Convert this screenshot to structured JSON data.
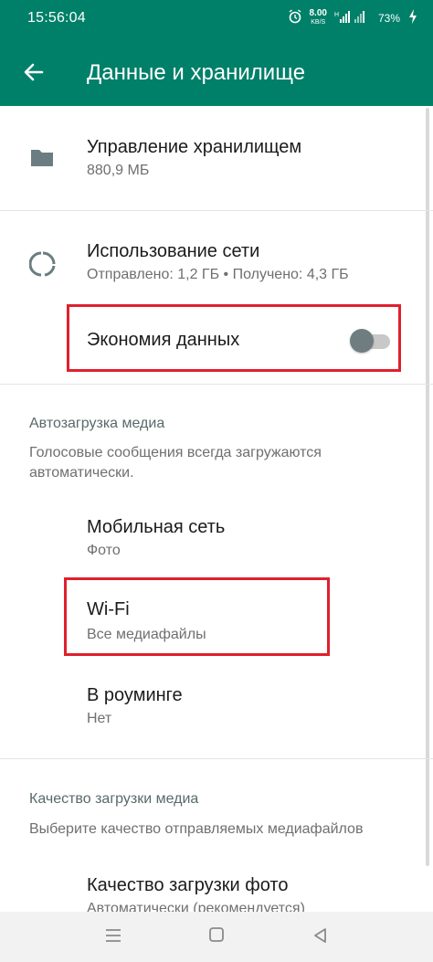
{
  "status_bar": {
    "time": "15:56:04",
    "net_speed_value": "8.00",
    "net_speed_unit": "KB/S",
    "battery": "73%"
  },
  "toolbar": {
    "title": "Данные и хранилище"
  },
  "storage": {
    "title": "Управление хранилищем",
    "subtitle": "880,9 МБ"
  },
  "network": {
    "title": "Использование сети",
    "subtitle": "Отправлено: 1,2 ГБ • Получено: 4,3 ГБ"
  },
  "data_saver": {
    "label": "Экономия данных",
    "enabled": false
  },
  "autodownload": {
    "header": "Автозагрузка медиа",
    "note": "Голосовые сообщения всегда загружаются автоматически.",
    "items": [
      {
        "title": "Мобильная сеть",
        "subtitle": "Фото"
      },
      {
        "title": "Wi-Fi",
        "subtitle": "Все медиафайлы"
      },
      {
        "title": "В роуминге",
        "subtitle": "Нет"
      }
    ]
  },
  "quality": {
    "header": "Качество загрузки медиа",
    "note": "Выберите качество отправляемых медиафайлов",
    "photo_title": "Качество загрузки фото",
    "photo_subtitle": "Автоматически (рекомендуется)"
  },
  "colors": {
    "brand": "#008069",
    "highlight": "#e0202d"
  },
  "icons": [
    "back-arrow-icon",
    "folder-icon",
    "data-usage-icon",
    "alarm-icon",
    "signal-icon",
    "battery-icon",
    "menu-nav-icon",
    "home-nav-icon",
    "back-nav-icon"
  ]
}
